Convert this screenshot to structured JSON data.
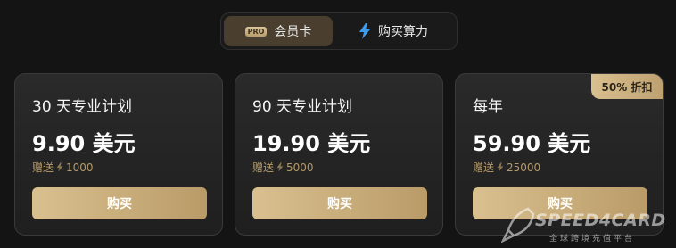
{
  "tabs": [
    {
      "badge": "PRO",
      "label": "会员卡",
      "active": true
    },
    {
      "icon": "lightning-icon",
      "label": "购买算力",
      "active": false
    }
  ],
  "plans": [
    {
      "name": "30 天专业计划",
      "price": "9.90 美元",
      "bonus_label": "赠送",
      "bonus_amount": "1000",
      "button": "购买",
      "discount": ""
    },
    {
      "name": "90 天专业计划",
      "price": "19.90 美元",
      "bonus_label": "赠送",
      "bonus_amount": "5000",
      "button": "购买",
      "discount": ""
    },
    {
      "name": "每年",
      "price": "59.90 美元",
      "bonus_label": "赠送",
      "bonus_amount": "25000",
      "button": "购买",
      "discount": "50% 折扣"
    }
  ],
  "watermark": {
    "brand": "SPEED4CARD",
    "tagline": "全球跨境充值平台"
  },
  "colors": {
    "accent": "#c9ad7c",
    "background": "#141414",
    "card": "#262626",
    "bolt": "#3b9cf0"
  }
}
